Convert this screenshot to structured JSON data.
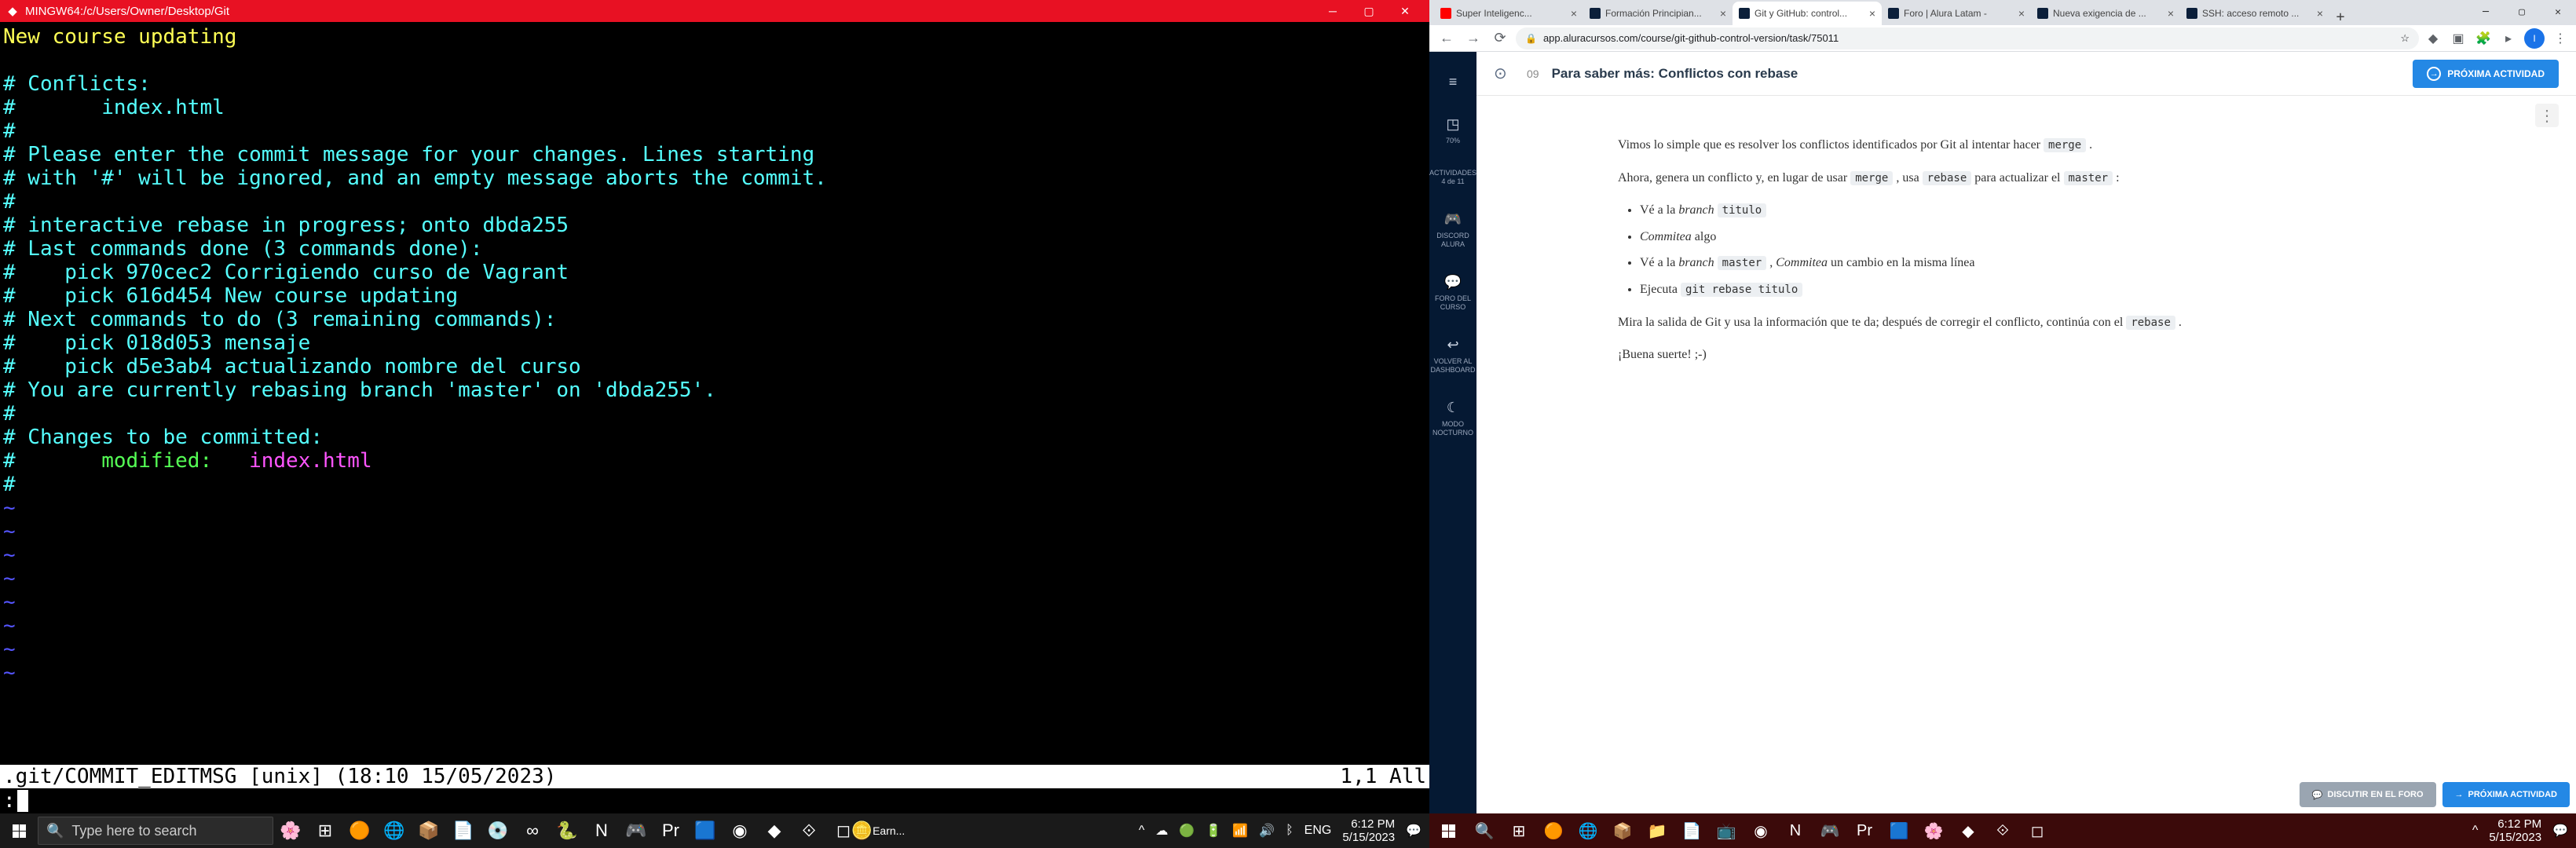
{
  "left": {
    "titlebar": "MINGW64:/c/Users/Owner/Desktop/Git",
    "vim": {
      "line1": "New course updating",
      "conflicts_label": "# Conflicts:",
      "conflict_file": "#       index.html",
      "commit_msg_1": "# Please enter the commit message for your changes. Lines starting",
      "commit_msg_2": "# with '#' will be ignored, and an empty message aborts the commit.",
      "rebase_1": "# interactive rebase in progress; onto dbda255",
      "rebase_2": "# Last commands done (3 commands done):",
      "rebase_3": "#    pick 970cec2 Corrigiendo curso de Vagrant",
      "rebase_4": "#    pick 616d454 New course updating",
      "rebase_5": "# Next commands to do (3 remaining commands):",
      "rebase_6": "#    pick 018d053 mensaje",
      "rebase_7": "#    pick d5e3ab4 actualizando nombre del curso",
      "rebase_8": "# You are currently rebasing branch 'master' on 'dbda255'.",
      "changes_label": "# Changes to be committed:",
      "modified_hash": "#       ",
      "modified_label": "modified:   ",
      "modified_file": "index.html",
      "status_left": ".git/COMMIT_EDITMSG [unix] (18:10 15/05/2023)",
      "status_right": "1,1 All",
      "colon": ":"
    },
    "taskbar": {
      "search_placeholder": "Type here to search",
      "earn": "Earn...",
      "lang": "ENG",
      "time": "6:12 PM",
      "date": "5/15/2023"
    }
  },
  "right": {
    "tabs": [
      {
        "title": "Super Inteligenc...",
        "favcls": "yt"
      },
      {
        "title": "Formación Principian..."
      },
      {
        "title": "Git y GitHub: control...",
        "active": true,
        "favcls": "git"
      },
      {
        "title": "Foro | Alura Latam -"
      },
      {
        "title": "Nueva exigencia de ..."
      },
      {
        "title": "SSH: acceso remoto ..."
      }
    ],
    "url": "app.aluracursos.com/course/git-github-control-version/task/75011",
    "sidebar": {
      "items": [
        {
          "label": "",
          "icon": "≡"
        },
        {
          "label": "70%",
          "icon": "◳"
        },
        {
          "label": "ACTIVIDADES\n4 de 11",
          "icon": ""
        },
        {
          "label": "DISCORD ALURA",
          "icon": "🎮"
        },
        {
          "label": "FORO DEL CURSO",
          "icon": "💬"
        },
        {
          "label": "VOLVER AL DASHBOARD",
          "icon": "↩"
        },
        {
          "label": "MODO NOCTURNO",
          "icon": "☾"
        }
      ]
    },
    "lesson": {
      "num": "09",
      "title": "Para saber más: Conflictos con rebase",
      "next_btn": "PRÓXIMA ACTIVIDAD",
      "p1_a": "Vimos lo simple que es resolver los conflictos identificados por Git al intentar hacer ",
      "merge": "merge",
      "p1_b": " .",
      "p2_a": "Ahora, genera un conflicto y, en lugar de usar ",
      "p2_b": " , usa ",
      "rebase": "rebase",
      "p2_c": " para actualizar el ",
      "master": "master",
      "p2_d": " :",
      "li1_a": "Vé a la ",
      "branch": "branch",
      "titulo": "titulo",
      "commitea": "Commitea",
      "li2_a": " algo",
      "li3_a": "Vé a la ",
      "li3_b": " , ",
      "li3_c": " un cambio en la misma línea",
      "li4_a": "Ejecuta ",
      "git_rebase": "git rebase titulo",
      "p3_a": "Mira la salida de Git y usa la información que te da; después de corregir el conflicto, continúa con el ",
      "p3_b": " .",
      "buena": "¡Buena suerte! ;-)",
      "discuss_btn": "DISCUTIR EN EL FORO"
    },
    "taskbar": {
      "time": "6:12 PM",
      "date": "5/15/2023"
    }
  }
}
